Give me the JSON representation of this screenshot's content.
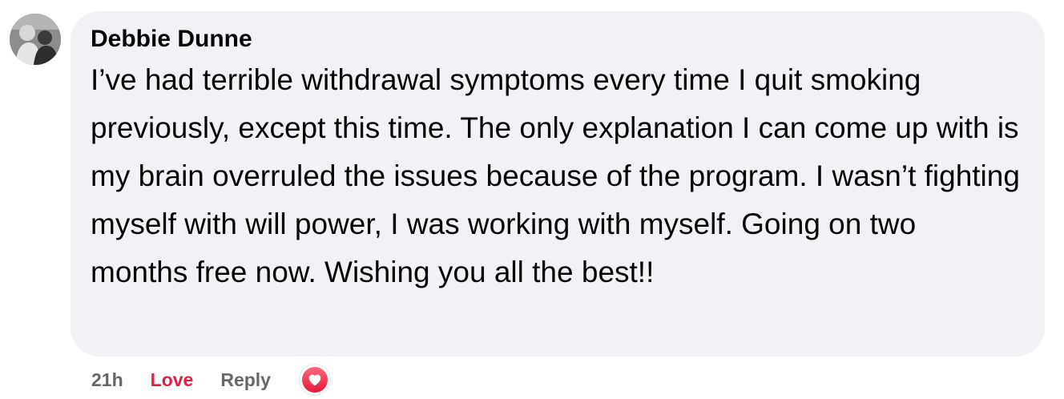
{
  "comment": {
    "author": "Debbie Dunne",
    "text": "I’ve had terrible withdrawal symptoms every time I quit smoking previously, except this time. The only explanation I can come up with is my brain overruled the issues because of the program. I wasn’t fighting myself with will power, I was working with myself. Going on two months free now. Wishing you all the best!!",
    "avatar_icon": "profile-photo",
    "bubble_color": "#f0f2f5"
  },
  "actions": {
    "timestamp": "21h",
    "love_label": "Love",
    "love_color": "#e41e3f",
    "reply_label": "Reply",
    "reaction_icon": "heart-icon"
  }
}
